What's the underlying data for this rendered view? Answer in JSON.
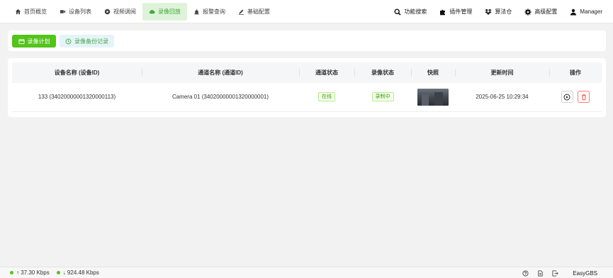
{
  "nav": {
    "items": [
      {
        "label": "首页概览",
        "icon": "home-icon"
      },
      {
        "label": "设备列表",
        "icon": "camera-icon"
      },
      {
        "label": "视频调阅",
        "icon": "play-circle-icon"
      },
      {
        "label": "录像回放",
        "icon": "cloud-icon",
        "active": true
      },
      {
        "label": "报警查询",
        "icon": "alarm-icon"
      },
      {
        "label": "基础配置",
        "icon": "edit-icon"
      }
    ],
    "right": [
      {
        "label": "功能搜索",
        "icon": "search-icon"
      },
      {
        "label": "插件管理",
        "icon": "puzzle-icon"
      },
      {
        "label": "算法仓",
        "icon": "dropbox-icon"
      },
      {
        "label": "高级配置",
        "icon": "gear-icon"
      },
      {
        "label": "Manager",
        "icon": "user-icon"
      }
    ]
  },
  "toolbar": {
    "plan_label": "录像计划",
    "backup_label": "录像备份记录"
  },
  "table": {
    "headers": [
      "设备名称 (设备ID)",
      "通道名称 (通道ID)",
      "通道状态",
      "录像状态",
      "快照",
      "更新时间",
      "操作"
    ],
    "rows": [
      {
        "device": "133 (34020000001320000113)",
        "channel": "Camera 01 (34020000001320000001)",
        "channel_status": "在线",
        "record_status": "录制中",
        "updated": "2025-06-25 10:29:34"
      }
    ]
  },
  "footer": {
    "upload": "↑ 37.30 Kbps",
    "download": "↓ 924.48 Kbps",
    "brand": "EasyGBS"
  },
  "colors": {
    "accent": "#52c41a",
    "active_nav_bg": "#dff3da",
    "danger": "#ff4d4f"
  }
}
